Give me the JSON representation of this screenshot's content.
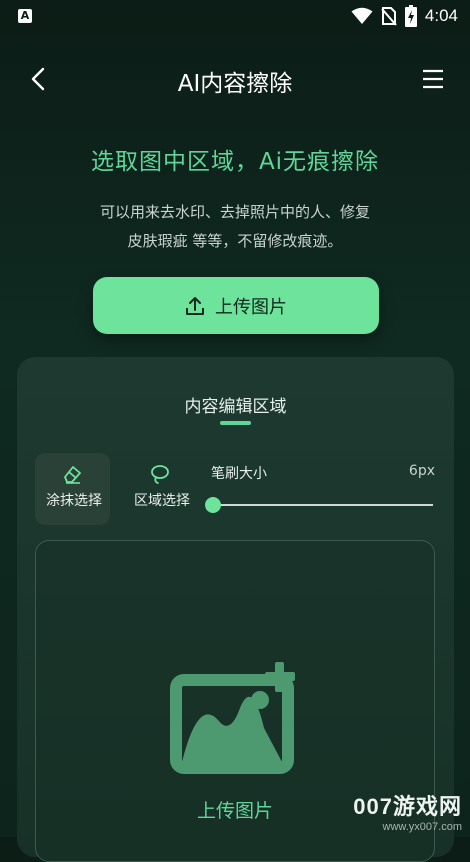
{
  "status_bar": {
    "left_badge": "A",
    "time": "4:04",
    "icons": [
      "wifi-icon",
      "no-sim-icon",
      "battery-charging-icon"
    ]
  },
  "header": {
    "title": "AI内容擦除",
    "back_icon": "back-arrow-icon",
    "menu_icon": "hamburger-menu-icon"
  },
  "hero": {
    "headline": "选取图中区域，Ai无痕擦除",
    "description_line1": "可以用来去水印、去掉照片中的人、修复",
    "description_line2": "皮肤瑕疵 等等，不留修改痕迹。",
    "upload_button": "上传图片",
    "upload_icon": "upload-icon"
  },
  "editor": {
    "tab_title": "内容编辑区域",
    "tools": [
      {
        "label": "涂抹选择",
        "icon": "eraser-icon",
        "active": true
      },
      {
        "label": "区域选择",
        "icon": "lasso-icon",
        "active": false
      }
    ],
    "brush": {
      "label": "笔刷大小",
      "value_text": "6px",
      "value": 6
    },
    "drop_zone": {
      "label": "上传图片",
      "icon": "add-image-icon"
    }
  },
  "watermark": {
    "main": "007游戏网",
    "sub": "www.yx007.com"
  },
  "colors": {
    "accent": "#6ee39b",
    "accent_text": "#5fd697",
    "background": "#0f2a21",
    "panel": "#1e3a30"
  }
}
